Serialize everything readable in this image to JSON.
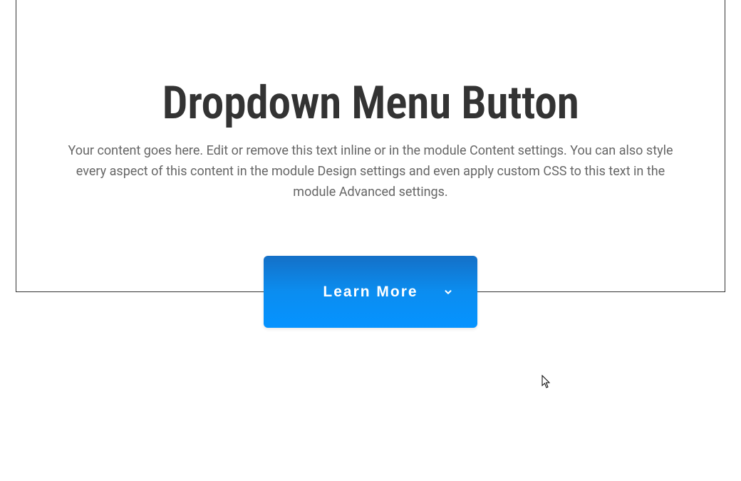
{
  "header": {
    "title": "Dropdown Menu Button",
    "description": "Your content goes here. Edit or remove this text inline or in the module Content settings. You can also style every aspect of this content in the module Design settings and even apply custom CSS to this text in the module Advanced settings."
  },
  "button": {
    "label": "Learn More"
  },
  "colors": {
    "button_gradient_top": "#1470c7",
    "button_gradient_bottom": "#0593ff",
    "text_heading": "#333333",
    "text_body": "#666666"
  }
}
